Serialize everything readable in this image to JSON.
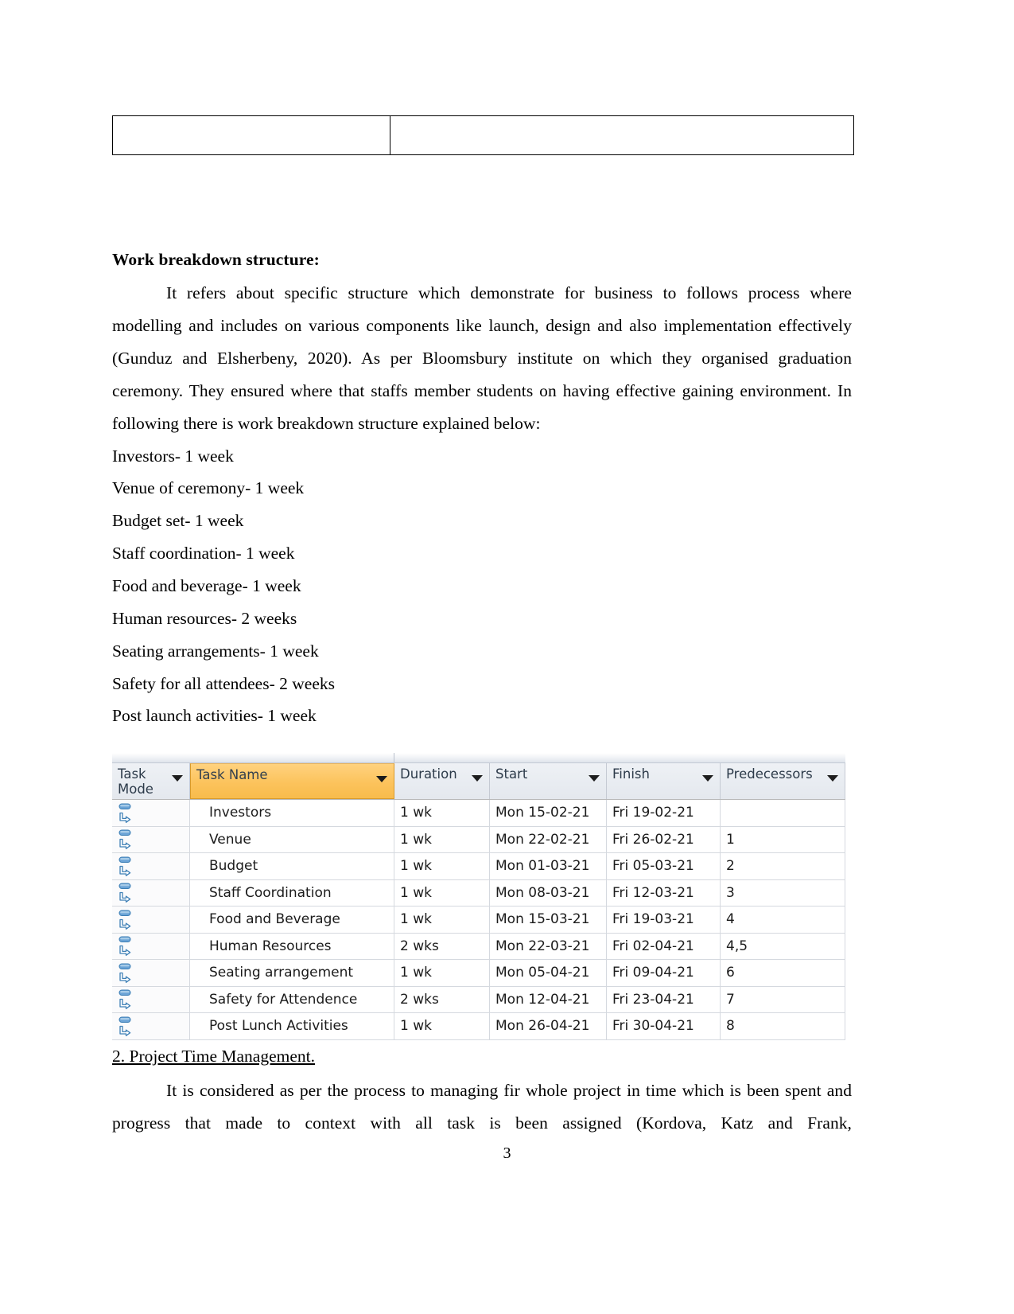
{
  "document": {
    "page_number": "3",
    "top_table": {
      "cell_left": "",
      "cell_right": ""
    },
    "section": {
      "heading": "Work breakdown structure:",
      "paragraph": "It refers about specific structure which demonstrate for business to follows process where modelling and includes on various components like launch, design and also implementation effectively (Gunduz and Elsherbeny, 2020). As per Bloomsbury institute on which they organised graduation ceremony. They ensured where that staffs member students on having effective gaining environment. In following there is work breakdown structure explained below:"
    },
    "wbs_items": [
      "Investors- 1 week",
      "Venue of ceremony- 1 week",
      "Budget set- 1 week",
      "Staff coordination- 1 week",
      "Food and beverage- 1 week",
      "Human resources- 2 weeks",
      "Seating arrangements- 1 week",
      "Safety for all attendees- 2 weeks",
      "Post launch activities- 1 week"
    ],
    "next_section": {
      "heading": "2. Project Time Management.",
      "paragraph": "It is considered as per the process to managing fir whole project in time which is been spent and progress that made to context with all task is been assigned  (Kordova, Katz and Frank,"
    }
  },
  "project_table": {
    "accent_header_color": "#f8bb4c",
    "header_background": "#e8ebef",
    "columns": [
      {
        "key": "task_mode",
        "label": "Task Mode",
        "has_filter": true,
        "highlighted": false
      },
      {
        "key": "task_name",
        "label": "Task Name",
        "has_filter": true,
        "highlighted": true
      },
      {
        "key": "duration",
        "label": "Duration",
        "has_filter": true,
        "highlighted": false
      },
      {
        "key": "start",
        "label": "Start",
        "has_filter": true,
        "highlighted": false
      },
      {
        "key": "finish",
        "label": "Finish",
        "has_filter": true,
        "highlighted": false
      },
      {
        "key": "predecessors",
        "label": "Predecessors",
        "has_filter": true,
        "highlighted": false
      }
    ],
    "mode_icon_name": "auto-scheduled-icon",
    "rows": [
      {
        "mode": "auto-scheduled-icon",
        "name": "Investors",
        "duration": "1 wk",
        "start": "Mon 15-02-21",
        "finish": "Fri 19-02-21",
        "predecessors": ""
      },
      {
        "mode": "auto-scheduled-icon",
        "name": "Venue",
        "duration": "1 wk",
        "start": "Mon 22-02-21",
        "finish": "Fri 26-02-21",
        "predecessors": "1"
      },
      {
        "mode": "auto-scheduled-icon",
        "name": "Budget",
        "duration": "1 wk",
        "start": "Mon 01-03-21",
        "finish": "Fri 05-03-21",
        "predecessors": "2"
      },
      {
        "mode": "auto-scheduled-icon",
        "name": "Staff Coordination",
        "duration": "1 wk",
        "start": "Mon 08-03-21",
        "finish": "Fri 12-03-21",
        "predecessors": "3"
      },
      {
        "mode": "auto-scheduled-icon",
        "name": "Food and Beverage",
        "duration": "1 wk",
        "start": "Mon 15-03-21",
        "finish": "Fri 19-03-21",
        "predecessors": "4"
      },
      {
        "mode": "auto-scheduled-icon",
        "name": "Human Resources",
        "duration": "2 wks",
        "start": "Mon 22-03-21",
        "finish": "Fri 02-04-21",
        "predecessors": "4,5"
      },
      {
        "mode": "auto-scheduled-icon",
        "name": "Seating arrangement",
        "duration": "1 wk",
        "start": "Mon 05-04-21",
        "finish": "Fri 09-04-21",
        "predecessors": "6"
      },
      {
        "mode": "auto-scheduled-icon",
        "name": "Safety for Attendence",
        "duration": "2 wks",
        "start": "Mon 12-04-21",
        "finish": "Fri 23-04-21",
        "predecessors": "7"
      },
      {
        "mode": "auto-scheduled-icon",
        "name": "Post Lunch Activities",
        "duration": "1 wk",
        "start": "Mon 26-04-21",
        "finish": "Fri 30-04-21",
        "predecessors": "8"
      }
    ]
  }
}
